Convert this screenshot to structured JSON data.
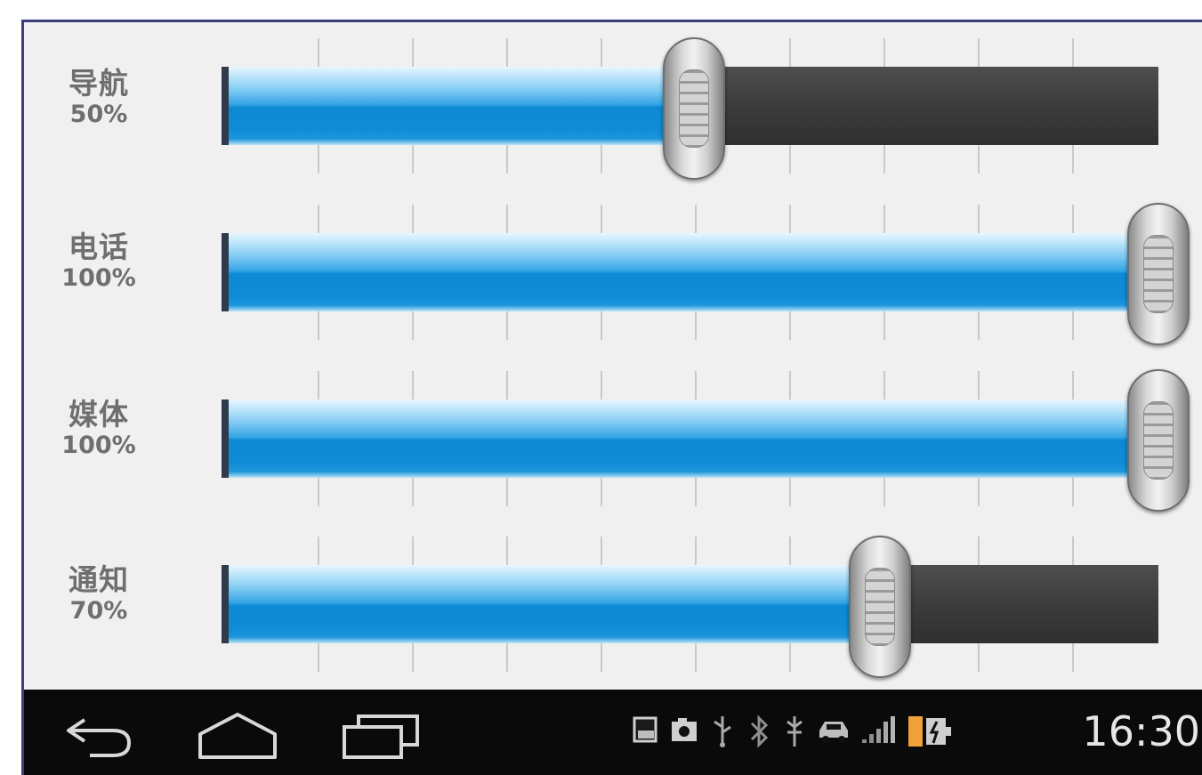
{
  "sliders": [
    {
      "name": "导航",
      "percent_label": "50%",
      "value": 50
    },
    {
      "name": "电话",
      "percent_label": "100%",
      "value": 100
    },
    {
      "name": "媒体",
      "percent_label": "100%",
      "value": 100
    },
    {
      "name": "通知",
      "percent_label": "70%",
      "value": 70
    }
  ],
  "status_bar": {
    "time": "16:30",
    "icons": [
      "gallery-icon",
      "camera-icon",
      "usb-icon",
      "bluetooth-icon",
      "usb-debug-icon",
      "car-icon",
      "signal-icon",
      "battery-icon"
    ]
  },
  "navigation": {
    "buttons": [
      "back-icon",
      "home-icon",
      "recent-apps-icon"
    ]
  },
  "colors": {
    "fill": "#0f8bd7",
    "track": "#3c3c3c",
    "label": "#6f6f6f",
    "panel": "#f0f0f0",
    "navbar": "#0a0a0a"
  }
}
